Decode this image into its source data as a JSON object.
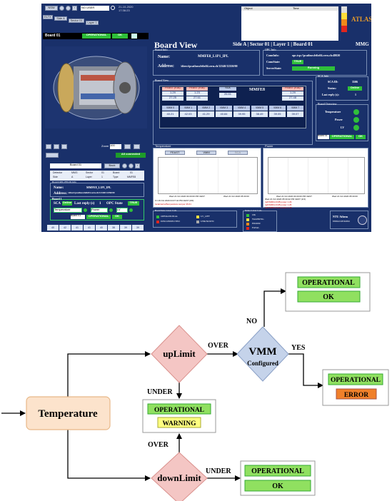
{
  "screenshot": {
    "toolbar": {
      "nsw_label": "NSW",
      "user": "NO USER",
      "datetime_line1": "21-10-2020",
      "datetime_line2": "17:36:23",
      "tabs": [
        "ELTX",
        "Side A",
        "Sector 01",
        "Layer 1"
      ],
      "board_label": "Board 01",
      "operational": "OPERATIONAL",
      "ok": "OK"
    },
    "alarm_table": {
      "col_object": "Object",
      "col_time": "Time"
    },
    "experiment_logo": "ATLAS",
    "board_view": {
      "title": "Board View",
      "location": "Side A | Sector 01 | Layer 1 | Board 01",
      "board_type": "MMG",
      "board_info_title": "Board Info",
      "name_label": "Name:",
      "name_value": "MMFE8_L1P1_IPL",
      "address_label": "Address:",
      "address_value": "/direct/pcatlnswfelix04.cern.ch/12340/12350/00"
    },
    "opc_info": {
      "title": "OPC Info",
      "conn_label": "ConnInfo:",
      "conn_value": "opc.tcp://pcatlnswfelix04.cern.ch:48020",
      "connstate_label": "ConnState:",
      "connstate_value": "TRUE",
      "serverstate_label": "ServerState:",
      "serverstate_value": "Running"
    },
    "sca_info": {
      "title": "SCA Info",
      "id_label": "SCA ID:",
      "id_value": "3506",
      "status_label": "Status:",
      "status_value": "Online",
      "reply_label": "Last reply (s):",
      "reply_value": "1"
    },
    "board_overview": {
      "title": "Board Overview",
      "items": [
        "Temperature",
        "Power",
        "LV"
      ],
      "board": "Board 01",
      "operational": "OPERATIONAL",
      "ok": "OK"
    },
    "feast": {
      "left_label": "FEAST (V1A)",
      "right_label": "FEAST (V1A)",
      "sca_label": "SCA",
      "chip_label": "MMFE8",
      "left_vals": [
        "1.29",
        "27.25"
      ],
      "mid_vals": [
        "1.23",
        "27.61"
      ],
      "sca_val": "26.61",
      "right_vals": [
        "1.29",
        "27.48"
      ]
    },
    "vmm": {
      "labels": [
        "VMM 0",
        "VMM 1",
        "VMM 2",
        "VMM 3",
        "VMM 4",
        "VMM 5",
        "VMM 6",
        "VMM 7"
      ],
      "values": [
        "40.21",
        "42.03",
        "41.29",
        "40.84",
        "39.95",
        "38.49",
        "39.05",
        "39.07"
      ]
    },
    "temperature_panel": {
      "title": "Temperature",
      "buttons": [
        "FEAST",
        "VMM",
        "SCA"
      ],
      "ticks": [
        "Wed 21 Oct 2020 04:00:00 PM CEST",
        "Wed 21 Oct 2020 05:30:00"
      ],
      "footer_time": "Fri 16 Oct 2020 04:07:44 PM CEST (0/0)",
      "footer_series": "/scaInternalTemperature.temper 26.61"
    },
    "power_panel": {
      "title": "Power",
      "ticks": [
        "Wed 21 Oct 2020 04:00:00 PM CEST",
        "Wed 21 Oct 2020 05:30:00"
      ],
      "footer_time": "Wed 21 Oct 2020 05:30:22 PM CEST (1/3)",
      "footer_series": [
        "/pdVMM0x1V2B power 1.29",
        "/pdVMM0x1V2B power 1.26",
        "/pdVMM0x1V2D power 1.26"
      ]
    },
    "legend_board": {
      "title": "Board State Colour Code",
      "items": [
        "OPERATIONAL",
        "LV_OFF",
        "DISCONNECTED",
        "UNKNOWN"
      ]
    },
    "legend_status": {
      "title": "Status Colour Code",
      "items": [
        "OK",
        "WARNING",
        "ERROR",
        "FATAL"
      ]
    },
    "ntua": {
      "name": "NTU Athens",
      "sub": "ΕΘΝΙΚΟ ΜΕΤΣΟΒΙΟ"
    },
    "left_lower": {
      "zoom_label": "Zoom",
      "zoom_value": "100",
      "connected": "All connected",
      "board_select": "Board 01",
      "back": "Back",
      "detector_label": "Detector",
      "detector": "MMG",
      "side_label": "Side",
      "side": "A",
      "sector_label": "Sector",
      "sector": "01",
      "layer_label": "Layer",
      "layer": "1",
      "board_label2": "Board",
      "board_num": "01",
      "type_label": "Type",
      "type": "MMFE8",
      "info_title": "Board OPC-FELIX Info",
      "name_label": "Name:",
      "name_value": "MMFE8_L1P1_IPL",
      "addr_label": "Address:",
      "addr_value": "/direct/pcatlnswfelix04.cern.ch/12340/12350/00",
      "group_title": "Board 1",
      "sca_label": "SCA",
      "sca_state": "Online",
      "last_reply": "Last reply (s)",
      "last_reply_val": "1",
      "opc_label": "OPC State",
      "opc_value": "TRUE",
      "temp": "Temperature",
      "power": "Power",
      "lv": "LV",
      "board": "Board 01",
      "operational": "OPERATIONAL",
      "ok": "OK",
      "mini_vmm": [
        "VMM 0",
        "VMM 1",
        "VMM 2",
        "VMM 3",
        "VMM 4",
        "VMM 5",
        "VMM 6",
        "VMM 7"
      ],
      "mini_vals": [
        "40",
        "42",
        "41",
        "41",
        "40",
        "38",
        "39",
        "39"
      ]
    }
  },
  "diagram": {
    "input_label": "Temperature",
    "uplimit_label": "upLimit",
    "downlimit_label": "downLimit",
    "vmm_title": "VMM",
    "vmm_sub": "Configured",
    "edge_over_top": "OVER",
    "edge_under_up": "UNDER",
    "edge_over_bottom": "OVER",
    "edge_under_down": "UNDER",
    "edge_no": "NO",
    "edge_yes": "YES",
    "state_label": "OPERATIONAL",
    "status_ok_top": "OK",
    "status_error": "ERROR",
    "status_warning": "WARNING",
    "status_ok_bottom": "OK",
    "colors": {
      "diamond_red": "#f4c6c4",
      "diamond_blue": "#c5d3ea",
      "input_fill": "#fce3cc",
      "green": "#90e060",
      "warning": "#ffff80",
      "error": "#f0802a"
    }
  }
}
